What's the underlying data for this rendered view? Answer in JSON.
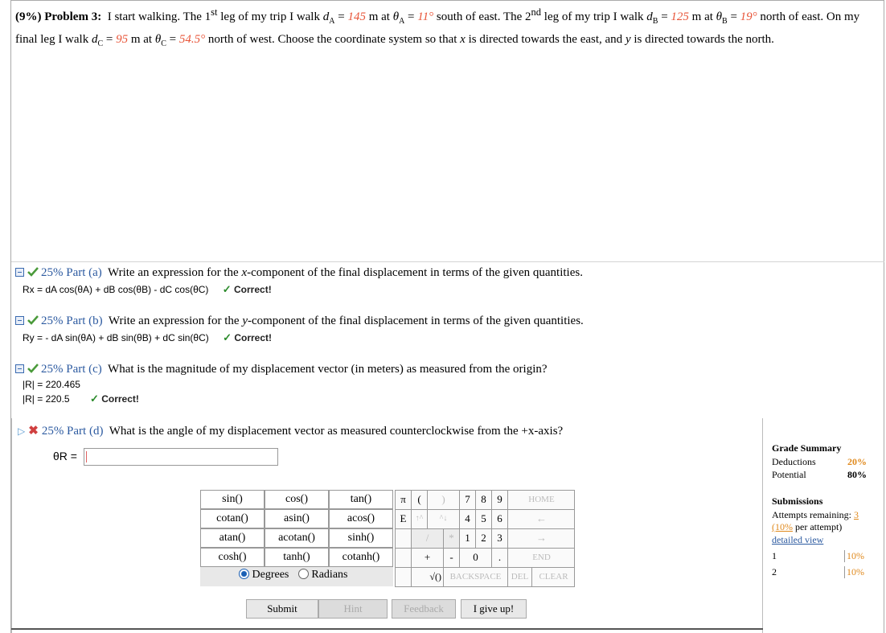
{
  "problem": {
    "prefix": "(9%) Problem 3:",
    "t1": "I start walking. The 1",
    "sup1": "st",
    "t2": " leg of my trip I walk ",
    "dA_sym": "d",
    "dA_sub": "A",
    "eq": " = ",
    "dA_val": "145",
    "unit_at": " m at ",
    "thA_sym": "θ",
    "thA_sub": "A",
    "thA_val": "11°",
    "thA_dir": " south of east. The 2",
    "sup2": "nd",
    "t3": " leg of my trip I walk ",
    "dB_sub": "B",
    "dB_val": "125",
    "thB_sub": "B",
    "thB_val": "19°",
    "thB_dir": " north of east. On my final leg I walk ",
    "dC_sub": "C",
    "dC_val": "95",
    "thC_sub": "C",
    "thC_val": "54.5°",
    "thC_dir": " north of west. Choose the coordinate system so that ",
    "x": "x",
    "t4": " is directed towards the east, and ",
    "y": "y",
    "t5": " is directed towards the north."
  },
  "parts": [
    {
      "label": "25% Part (a)",
      "question_pre": "Write an expression for the ",
      "question_var": "x",
      "question_post": "-component of the final displacement in terms of the given quantities.",
      "answer": "Rx = dA cos(θA) + dB cos(θB) - dC cos(θC)",
      "status": "Correct!"
    },
    {
      "label": "25% Part (b)",
      "question_pre": "Write an expression for the ",
      "question_var": "y",
      "question_post": "-component of the final displacement in terms of the given quantities.",
      "answer": "Ry = - dA sin(θA) + dB sin(θB) + dC sin(θC)",
      "status": "Correct!"
    },
    {
      "label": "25% Part (c)",
      "question": "What is the magnitude of my displacement vector (in meters) as measured from the origin?",
      "answer1": "|R| = 220.465",
      "answer2": "|R| = 220.5",
      "status": "Correct!"
    },
    {
      "label": "25% Part (d)",
      "question": "What is the angle of my displacement vector as measured counterclockwise from the +x-axis?",
      "input_label": "θR =",
      "input_value": ""
    }
  ],
  "functions": [
    [
      "sin()",
      "cos()",
      "tan()"
    ],
    [
      "cotan()",
      "asin()",
      "acos()"
    ],
    [
      "atan()",
      "acotan()",
      "sinh()"
    ],
    [
      "cosh()",
      "tanh()",
      "cotanh()"
    ]
  ],
  "angle_mode": {
    "degrees": "Degrees",
    "radians": "Radians",
    "selected": "degrees"
  },
  "keypad": {
    "row1": [
      "π",
      "(",
      ")",
      "7",
      "8",
      "9",
      "HOME"
    ],
    "row2": [
      "E",
      "↑^",
      "^↓",
      "4",
      "5",
      "6",
      "←"
    ],
    "row3": [
      "",
      "/",
      "*",
      "1",
      "2",
      "3",
      "→"
    ],
    "row4": [
      "",
      "+",
      "-",
      "0",
      ".",
      "END"
    ],
    "row5": [
      "√()",
      "BACKSPACE",
      "DEL",
      "CLEAR"
    ]
  },
  "buttons": {
    "submit": "Submit",
    "hint": "Hint",
    "feedback": "Feedback",
    "give_up": "I give up!"
  },
  "grade_summary": {
    "title": "Grade Summary",
    "deductions_label": "Deductions",
    "deductions_value": "20%",
    "potential_label": "Potential",
    "potential_value": "80%",
    "submissions_title": "Submissions",
    "attempts_label": "Attempts remaining:",
    "attempts_value": "3",
    "per_attempt_pct": "(10%",
    "per_attempt_text": " per attempt)",
    "detailed_view": "detailed view",
    "rows": [
      {
        "n": "1",
        "pct": "10%"
      },
      {
        "n": "2",
        "pct": "10%"
      }
    ]
  },
  "colors": {
    "accent": "#2c5aa0",
    "given_value": "#e8563a",
    "grade_orange": "#e08a1e"
  }
}
